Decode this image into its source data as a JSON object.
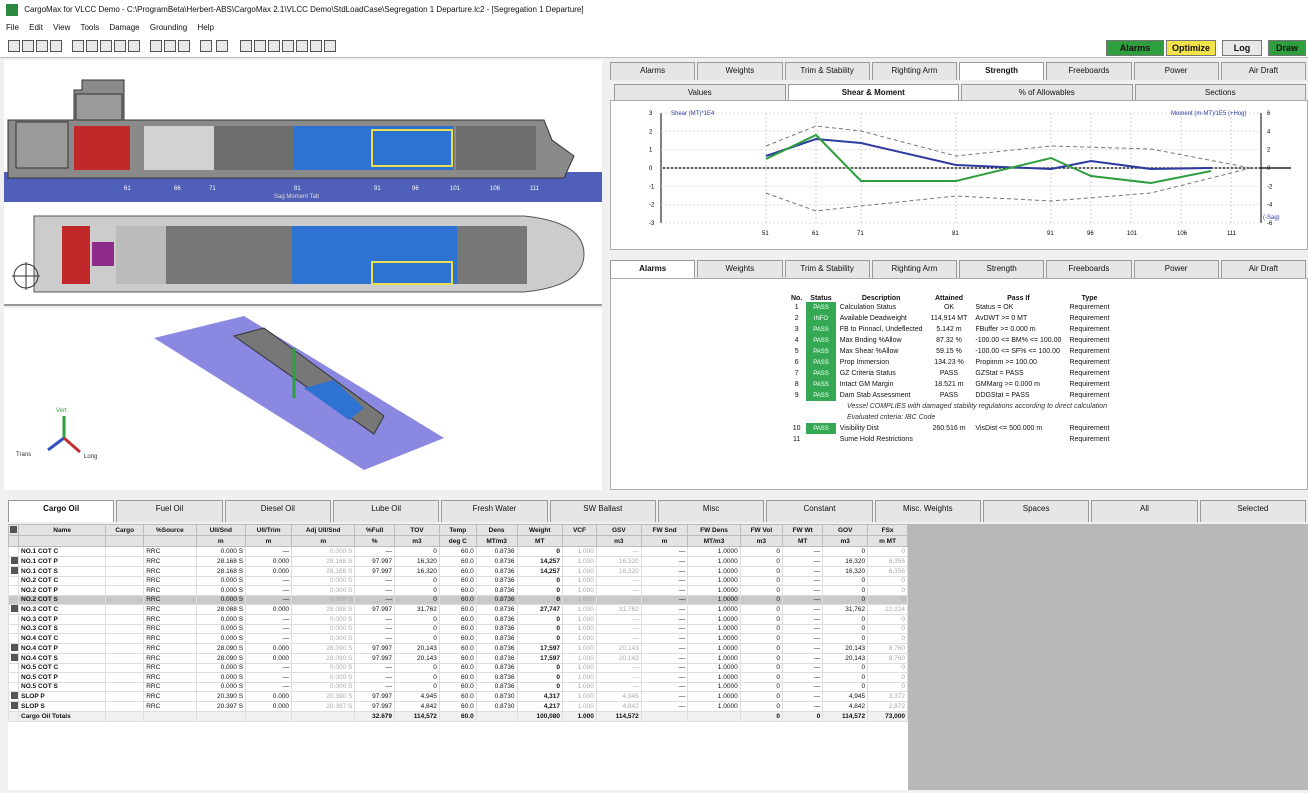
{
  "window": {
    "title": "CargoMax for VLCC Demo - C:\\ProgramBeta\\Herbert-ABS\\CargoMax 2.1\\VLCC Demo\\StdLoadCase\\Segregation 1 Departure.lc2 - [Segregation 1 Departure]"
  },
  "menu": [
    "File",
    "Edit",
    "View",
    "Tools",
    "Damage",
    "Grounding",
    "Help"
  ],
  "status_buttons": [
    {
      "label": "Alarms",
      "color": "#2e9e3e"
    },
    {
      "label": "Optimize",
      "color": "#f3e34a"
    },
    {
      "label": "Log",
      "color": "#e8e8e8"
    },
    {
      "label": "Draw",
      "color": "#2e9e3e"
    }
  ],
  "upper_tabs": [
    "Alarms",
    "Weights",
    "Trim & Stability",
    "Righting Arm",
    "Strength",
    "Freeboards",
    "Power",
    "Air Draft"
  ],
  "upper_active": "Strength",
  "strength_subtabs": [
    "Values",
    "Shear & Moment",
    "% of Allowables",
    "Sections"
  ],
  "strength_active": "Shear & Moment",
  "strength_chart": {
    "left_legend": "Shear (MT)*1E4",
    "right_legend": "Moment (m-MT)/1E5 (+Hog)",
    "sag_label": "(-Sag)",
    "ylim": [
      -3,
      3
    ],
    "y2lim": [
      -6,
      6
    ],
    "x_ticks": [
      "51",
      "61",
      "71",
      "81",
      "91",
      "96",
      "101",
      "106",
      "111"
    ],
    "left_ticks": [
      "3",
      "2",
      "1",
      "0",
      "-1",
      "-2",
      "-3"
    ],
    "right_ticks": [
      "6",
      "4",
      "2",
      "0",
      "-2",
      "-4",
      "-6"
    ]
  },
  "profile": {
    "frame_labels": [
      "61",
      "66",
      "71",
      "81",
      "91",
      "96",
      "101",
      "106",
      "111"
    ],
    "sag_text": "Sag  Moment  Tab"
  },
  "alarm_tabs": [
    "Alarms",
    "Weights",
    "Trim & Stability",
    "Righting Arm",
    "Strength",
    "Freeboards",
    "Power",
    "Air Draft"
  ],
  "alarm_active": "Alarms",
  "alarm_headers": [
    "No.",
    "Status",
    "Description",
    "Attained",
    "Pass If",
    "Type"
  ],
  "alarms": [
    {
      "no": "1",
      "status": "PASS",
      "desc": "Calculation Status",
      "attained": "OK",
      "pass": "Status = OK",
      "type": "Requirement"
    },
    {
      "no": "2",
      "status": "INFO",
      "desc": "Available Deadweight",
      "attained": "114,914 MT",
      "pass": "AvDWT >= 0 MT",
      "type": "Requirement"
    },
    {
      "no": "3",
      "status": "PASS",
      "desc": "FB to Pinnacl, Undeflected",
      "attained": "5.142 m",
      "pass": "FBuffer >= 0.000 m",
      "type": "Requirement"
    },
    {
      "no": "4",
      "status": "PASS",
      "desc": "Max Bnding %Allow",
      "attained": "87.32 %",
      "pass": "-100.00 <= BM% <= 100.00",
      "type": "Requirement"
    },
    {
      "no": "5",
      "status": "PASS",
      "desc": "Max Shear %Allow",
      "attained": "59.15 %",
      "pass": "-100.00 <= SF% <= 100.00",
      "type": "Requirement"
    },
    {
      "no": "6",
      "status": "PASS",
      "desc": "Prop Immersion",
      "attained": "134.23 %",
      "pass": "Propimm >= 100.00",
      "type": "Requirement"
    },
    {
      "no": "7",
      "status": "PASS",
      "desc": "GZ Criteria Status",
      "attained": "PASS",
      "pass": "GZStat = PASS",
      "type": "Requirement"
    },
    {
      "no": "8",
      "status": "PASS",
      "desc": "Intact GM Margin",
      "attained": "18.521 m",
      "pass": "GMMarg >= 0.000 m",
      "type": "Requirement"
    },
    {
      "no": "9",
      "status": "PASS",
      "desc": "Dam Stab Assessment",
      "attained": "PASS",
      "pass": "DDGStat = PASS",
      "type": "Requirement"
    }
  ],
  "alarm_note1": "Vessel COMPLIES with damaged stability regulations according to direct calculation",
  "alarm_note2": "Evaluated criteria: IBC Code",
  "alarms_extra": [
    {
      "no": "10",
      "status": "PASS",
      "desc": "Visibility Dist",
      "attained": "260.516 m",
      "pass": "VisDist <= 500.000 m",
      "type": "Requirement"
    },
    {
      "no": "11",
      "status": "",
      "desc": "Sume Hold Restrictions",
      "attained": "",
      "pass": "",
      "type": "Requirement"
    }
  ],
  "view3d": {
    "axis_labels": [
      "Vert",
      "Trans",
      "Long"
    ]
  },
  "bottom_tabs": [
    "Cargo Oil",
    "Fuel Oil",
    "Diesel Oil",
    "Lube Oil",
    "Fresh Water",
    "SW Ballast",
    "Misc",
    "Constant",
    "Misc. Weights",
    "Spaces",
    "All",
    "Selected"
  ],
  "bottom_active": "Cargo Oil",
  "cargo_headers": [
    "Name",
    "Cargo",
    "%Source",
    "Ull/Snd",
    "Ull/Trim",
    "Adj Ull/Snd",
    "%Full",
    "TOV",
    "Temp",
    "Dens",
    "Weight",
    "VCF",
    "GSV",
    "FW Snd",
    "FW Dens",
    "FW Vol",
    "FW Wt",
    "GOV",
    "FSx"
  ],
  "cargo_units": [
    "",
    "",
    "",
    "m",
    "m",
    "m",
    "%",
    "m3",
    "deg C",
    "MT/m3",
    "MT",
    "",
    "m3",
    "m",
    "MT/m3",
    "m3",
    "MT",
    "m3",
    "m MT"
  ],
  "cargo_rows": [
    {
      "mark": false,
      "name": "NO.1 COT C",
      "src": "RRC",
      "ull": "0.000 S",
      "trim": "—",
      "adj": "0.000 S",
      "full": "—",
      "tov": "0",
      "temp": "60.0",
      "dens": "0.8736",
      "wt": "0",
      "vcf": "1.000",
      "gsv": "—",
      "fws": "—",
      "fwd": "1.0000",
      "fwv": "0",
      "fww": "—",
      "gov": "0",
      "fsx": "0"
    },
    {
      "mark": true,
      "name": "NO.1 COT P",
      "src": "RRC",
      "ull": "28.168 S",
      "trim": "0.000",
      "adj": "28.168 S",
      "full": "97.997",
      "tov": "16,320",
      "temp": "60.0",
      "dens": "0.8736",
      "wt": "14,257",
      "vcf": "1.000",
      "gsv": "16,320",
      "fws": "—",
      "fwd": "1.0000",
      "fwv": "0",
      "fww": "—",
      "gov": "16,320",
      "fsx": "6,356"
    },
    {
      "mark": true,
      "name": "NO.1 COT S",
      "src": "RRC",
      "ull": "28.168 S",
      "trim": "0.000",
      "adj": "28.168 S",
      "full": "97.997",
      "tov": "16,320",
      "temp": "60.0",
      "dens": "0.8736",
      "wt": "14,257",
      "vcf": "1.000",
      "gsv": "16,320",
      "fws": "—",
      "fwd": "1.0000",
      "fwv": "0",
      "fww": "—",
      "gov": "16,320",
      "fsx": "6,356"
    },
    {
      "mark": false,
      "name": "NO.2 COT C",
      "src": "RRC",
      "ull": "0.000 S",
      "trim": "—",
      "adj": "0.000 S",
      "full": "—",
      "tov": "0",
      "temp": "60.0",
      "dens": "0.8736",
      "wt": "0",
      "vcf": "1.000",
      "gsv": "—",
      "fws": "—",
      "fwd": "1.0000",
      "fwv": "0",
      "fww": "—",
      "gov": "0",
      "fsx": "0"
    },
    {
      "mark": false,
      "name": "NO.2 COT P",
      "src": "RRC",
      "ull": "0.000 S",
      "trim": "—",
      "adj": "0.000 S",
      "full": "—",
      "tov": "0",
      "temp": "60.0",
      "dens": "0.8736",
      "wt": "0",
      "vcf": "1.000",
      "gsv": "—",
      "fws": "—",
      "fwd": "1.0000",
      "fwv": "0",
      "fww": "—",
      "gov": "0",
      "fsx": "0"
    },
    {
      "mark": false,
      "sel": true,
      "name": "NO.2 COT S",
      "src": "RRC",
      "ull": "0.000 S",
      "trim": "—",
      "adj": "0.000 S",
      "full": "—",
      "tov": "0",
      "temp": "60.0",
      "dens": "0.8736",
      "wt": "0",
      "vcf": "1.000",
      "gsv": "—",
      "fws": "—",
      "fwd": "1.0000",
      "fwv": "0",
      "fww": "—",
      "gov": "0",
      "fsx": "0"
    },
    {
      "mark": true,
      "name": "NO.3 COT C",
      "src": "RRC",
      "ull": "28.088 S",
      "trim": "0.000",
      "adj": "28.088 S",
      "full": "97.997",
      "tov": "31,762",
      "temp": "60.0",
      "dens": "0.8736",
      "wt": "27,747",
      "vcf": "1.000",
      "gsv": "31,762",
      "fws": "—",
      "fwd": "1.0000",
      "fwv": "0",
      "fww": "—",
      "gov": "31,762",
      "fsx": "22,224"
    },
    {
      "mark": false,
      "name": "NO.3 COT P",
      "src": "RRC",
      "ull": "0.000 S",
      "trim": "—",
      "adj": "0.000 S",
      "full": "—",
      "tov": "0",
      "temp": "60.0",
      "dens": "0.8736",
      "wt": "0",
      "vcf": "1.000",
      "gsv": "—",
      "fws": "—",
      "fwd": "1.0000",
      "fwv": "0",
      "fww": "—",
      "gov": "0",
      "fsx": "0"
    },
    {
      "mark": false,
      "name": "NO.3 COT S",
      "src": "RRC",
      "ull": "0.000 S",
      "trim": "—",
      "adj": "0.000 S",
      "full": "—",
      "tov": "0",
      "temp": "60.0",
      "dens": "0.8736",
      "wt": "0",
      "vcf": "1.000",
      "gsv": "—",
      "fws": "—",
      "fwd": "1.0000",
      "fwv": "0",
      "fww": "—",
      "gov": "0",
      "fsx": "0"
    },
    {
      "mark": false,
      "name": "NO.4 COT C",
      "src": "RRC",
      "ull": "0.000 S",
      "trim": "—",
      "adj": "0.000 S",
      "full": "—",
      "tov": "0",
      "temp": "60.0",
      "dens": "0.8736",
      "wt": "0",
      "vcf": "1.000",
      "gsv": "—",
      "fws": "—",
      "fwd": "1.0000",
      "fwv": "0",
      "fww": "—",
      "gov": "0",
      "fsx": "0"
    },
    {
      "mark": true,
      "name": "NO.4 COT P",
      "src": "RRC",
      "ull": "28.090 S",
      "trim": "0.000",
      "adj": "28.090 S",
      "full": "97.997",
      "tov": "20,143",
      "temp": "60.0",
      "dens": "0.8736",
      "wt": "17,597",
      "vcf": "1.000",
      "gsv": "20,143",
      "fws": "—",
      "fwd": "1.0000",
      "fwv": "0",
      "fww": "—",
      "gov": "20,143",
      "fsx": "8,760"
    },
    {
      "mark": true,
      "name": "NO.4 COT S",
      "src": "RRC",
      "ull": "28.090 S",
      "trim": "0.000",
      "adj": "28.090 S",
      "full": "97.997",
      "tov": "20,143",
      "temp": "60.0",
      "dens": "0.8736",
      "wt": "17,597",
      "vcf": "1.000",
      "gsv": "20,143",
      "fws": "—",
      "fwd": "1.0000",
      "fwv": "0",
      "fww": "—",
      "gov": "20,143",
      "fsx": "8,760"
    },
    {
      "mark": false,
      "name": "NO.5 COT C",
      "src": "RRC",
      "ull": "0.000 S",
      "trim": "—",
      "adj": "0.000 S",
      "full": "—",
      "tov": "0",
      "temp": "60.0",
      "dens": "0.8736",
      "wt": "0",
      "vcf": "1.000",
      "gsv": "—",
      "fws": "—",
      "fwd": "1.0000",
      "fwv": "0",
      "fww": "—",
      "gov": "0",
      "fsx": "0"
    },
    {
      "mark": false,
      "name": "NO.5 COT P",
      "src": "RRC",
      "ull": "0.000 S",
      "trim": "—",
      "adj": "0.000 S",
      "full": "—",
      "tov": "0",
      "temp": "60.0",
      "dens": "0.8736",
      "wt": "0",
      "vcf": "1.000",
      "gsv": "—",
      "fws": "—",
      "fwd": "1.0000",
      "fwv": "0",
      "fww": "—",
      "gov": "0",
      "fsx": "0"
    },
    {
      "mark": false,
      "name": "NO.5 COT S",
      "src": "RRC",
      "ull": "0.000 S",
      "trim": "—",
      "adj": "0.000 S",
      "full": "—",
      "tov": "0",
      "temp": "60.0",
      "dens": "0.8736",
      "wt": "0",
      "vcf": "1.000",
      "gsv": "—",
      "fws": "—",
      "fwd": "1.0000",
      "fwv": "0",
      "fww": "—",
      "gov": "0",
      "fsx": "0"
    },
    {
      "mark": true,
      "name": "SLOP P",
      "src": "RRC",
      "ull": "20.390 S",
      "trim": "0.000",
      "adj": "20.390 S",
      "full": "97.997",
      "tov": "4,945",
      "temp": "60.0",
      "dens": "0.8730",
      "wt": "4,317",
      "vcf": "1.000",
      "gsv": "4,945",
      "fws": "—",
      "fwd": "1.0000",
      "fwv": "0",
      "fww": "—",
      "gov": "4,945",
      "fsx": "3,372"
    },
    {
      "mark": true,
      "name": "SLOP S",
      "src": "RRC",
      "ull": "20.397 S",
      "trim": "0.000",
      "adj": "20.397 S",
      "full": "97.997",
      "tov": "4,842",
      "temp": "60.0",
      "dens": "0.8730",
      "wt": "4,217",
      "vcf": "1.000",
      "gsv": "4,842",
      "fws": "—",
      "fwd": "1.0000",
      "fwv": "0",
      "fww": "—",
      "gov": "4,842",
      "fsx": "2,872"
    }
  ],
  "cargo_totals": {
    "name": "Cargo Oil Totals",
    "full": "32.679",
    "tov": "114,572",
    "temp": "60.0",
    "wt": "100,080",
    "vcf": "1.000",
    "gsv": "114,572",
    "fwv": "0",
    "fww": "0",
    "gov": "114,572",
    "fsx": "73,000"
  }
}
